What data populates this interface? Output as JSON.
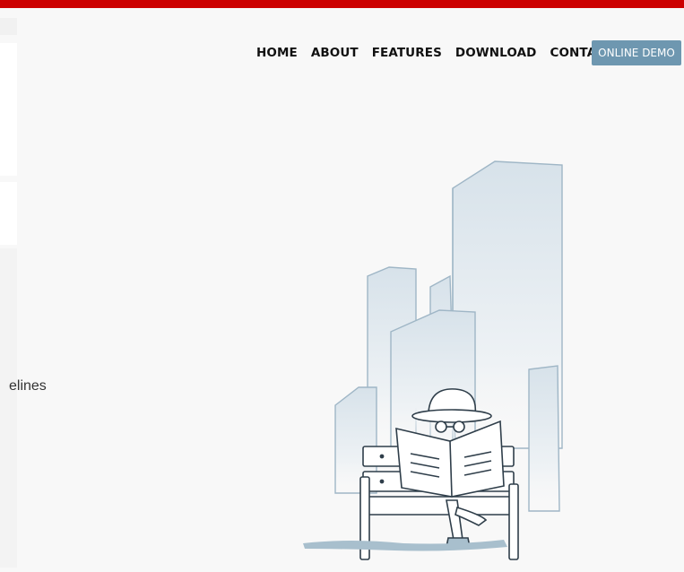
{
  "nav": {
    "items": [
      {
        "label": "HOME"
      },
      {
        "label": "ABOUT"
      },
      {
        "label": "FEATURES"
      },
      {
        "label": "DOWNLOAD"
      },
      {
        "label": "CONTACT"
      }
    ],
    "demo_label": "ONLINE DEMO"
  },
  "body": {
    "partial_text": "elines"
  },
  "colors": {
    "top_bar": "#cc0000",
    "demo_button": "#6e97b0",
    "background": "#f8f8f8"
  },
  "illustration": {
    "icon": "spy-reading-newspaper-on-bench-illustration"
  }
}
